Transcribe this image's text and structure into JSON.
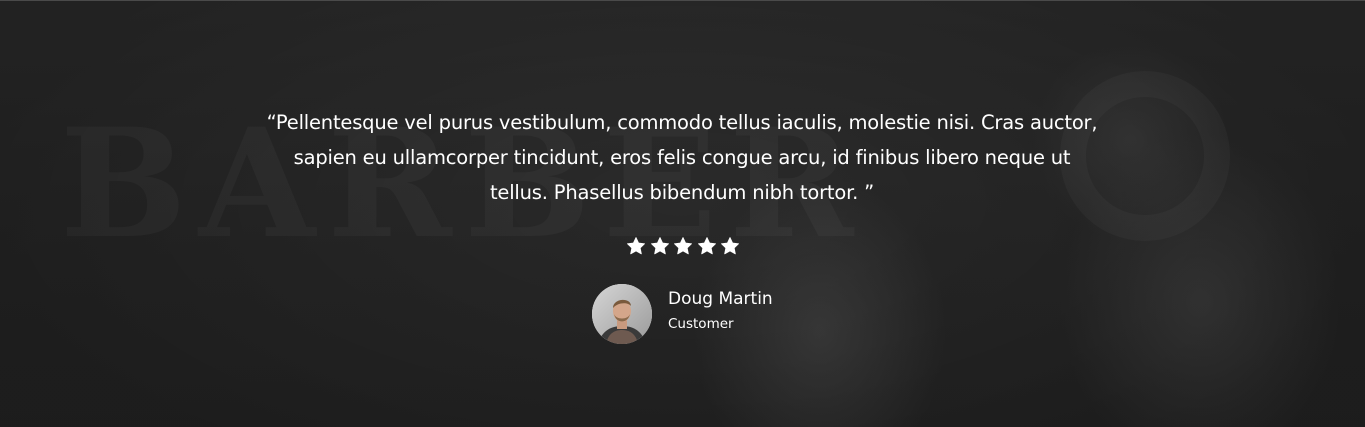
{
  "testimonial": {
    "quote": "“Pellentesque vel purus vestibulum, commodo tellus iaculis, molestie nisi. Cras auctor, sapien eu ullamcorper tincidunt, eros felis congue arcu, id finibus libero neque ut tellus. Phasellus bibendum nibh tortor. ”",
    "rating": 5,
    "rating_max": 5,
    "author_name": "Doug Martin",
    "author_role": "Customer",
    "star_icon": "star-icon",
    "avatar_icon": "avatar-photo"
  },
  "colors": {
    "background": "#2b2b2b",
    "text": "#ffffff",
    "star": "#ffffff"
  }
}
